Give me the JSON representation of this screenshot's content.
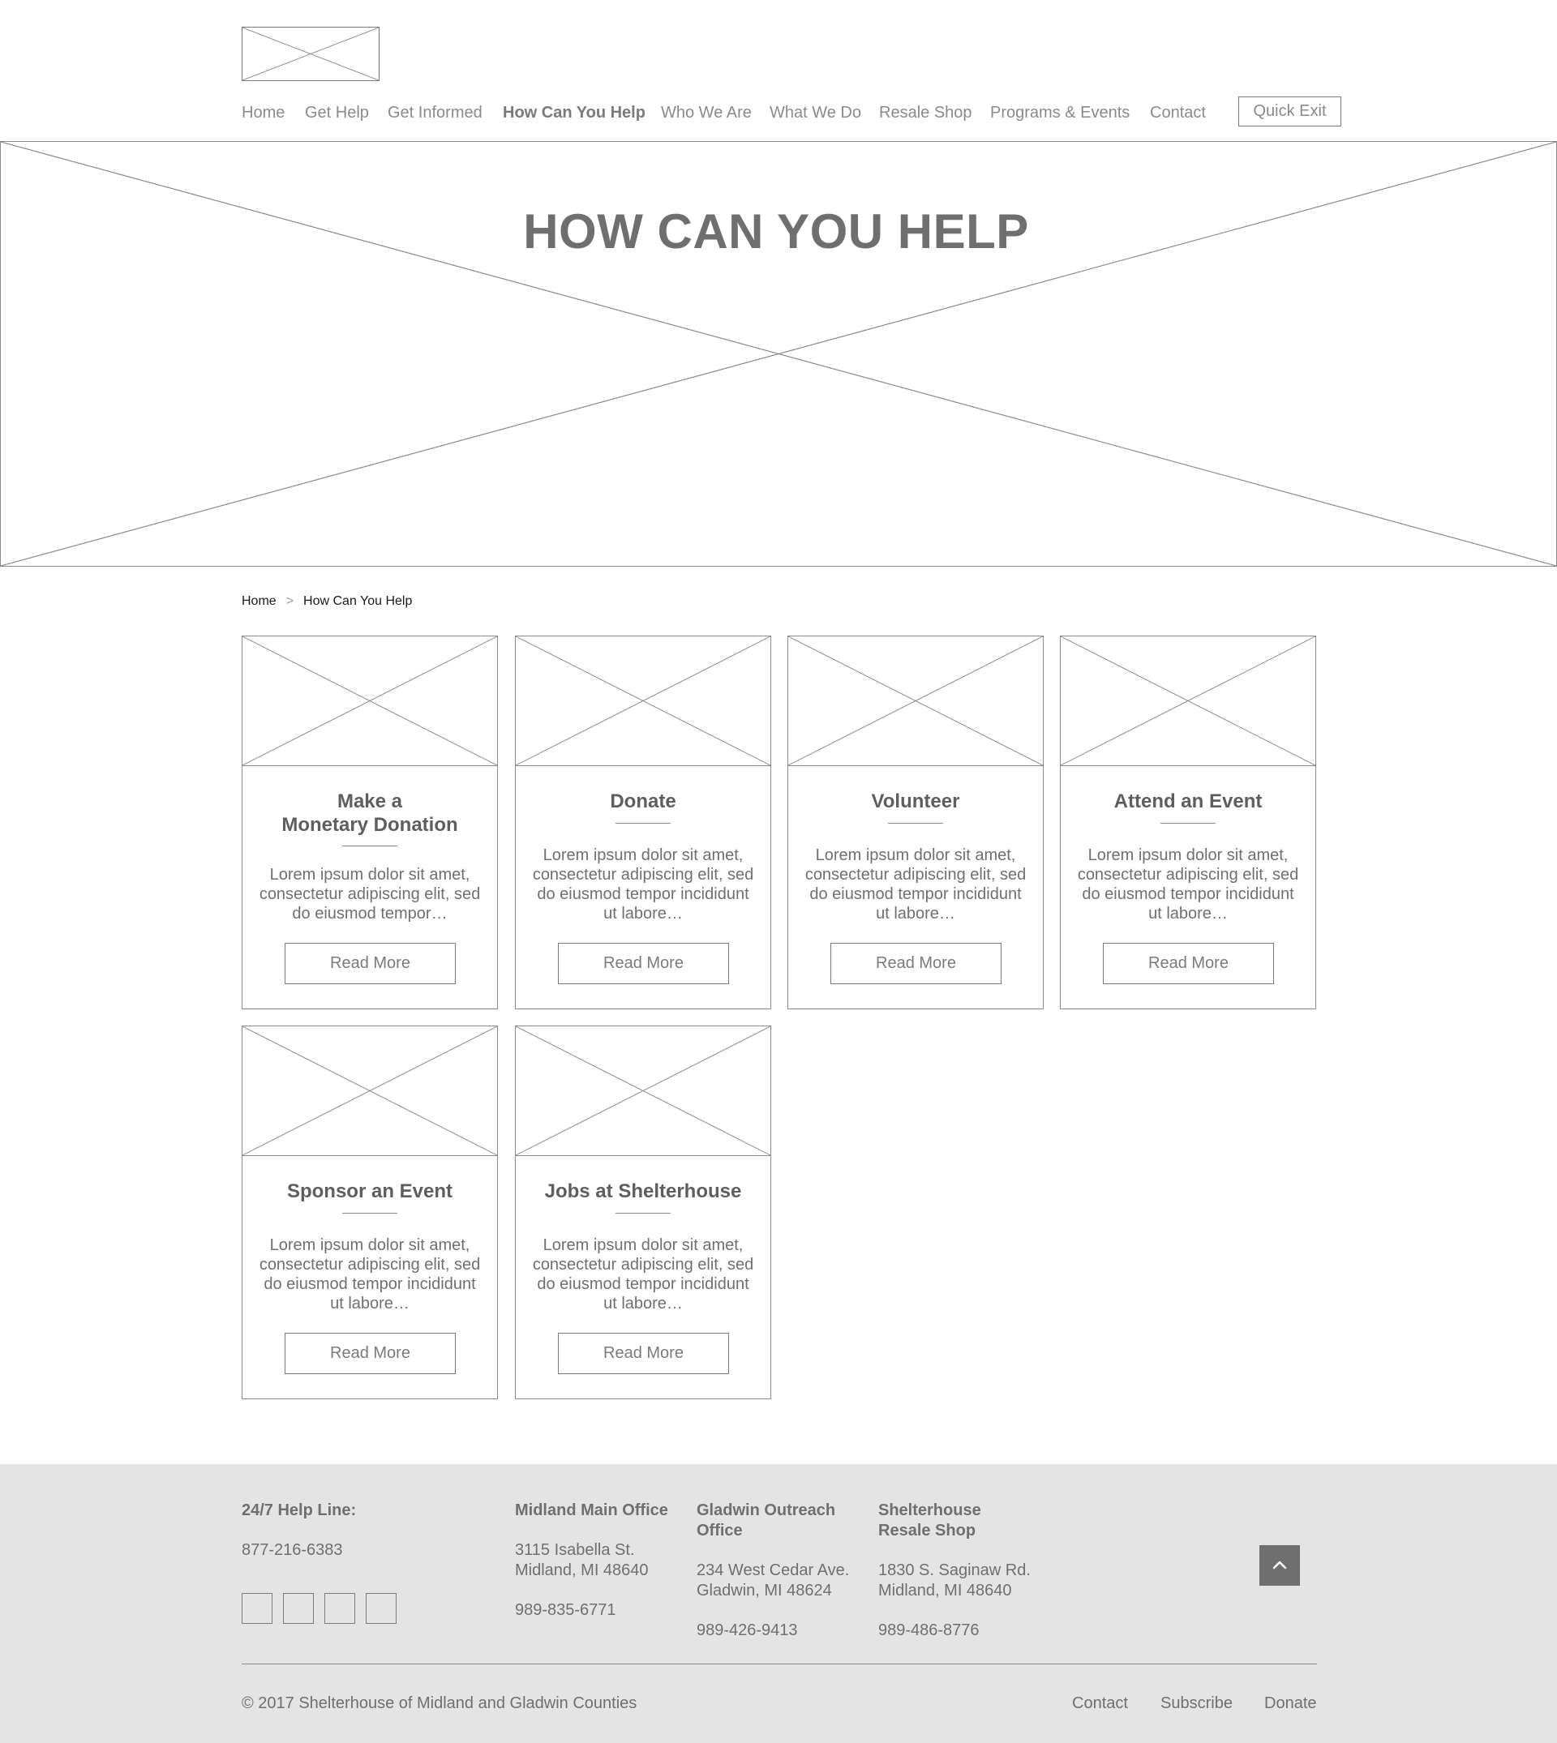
{
  "header": {
    "nav": [
      {
        "label": "Home",
        "active": false
      },
      {
        "label": "Get Help",
        "active": false
      },
      {
        "label": "Get Informed",
        "active": false
      },
      {
        "label": "How Can You Help",
        "active": true
      },
      {
        "label": "Who We Are",
        "active": false
      },
      {
        "label": "What We Do",
        "active": false
      },
      {
        "label": "Resale Shop",
        "active": false
      },
      {
        "label": "Programs & Events",
        "active": false
      },
      {
        "label": "Contact",
        "active": false
      }
    ],
    "quick_exit_label": "Quick Exit"
  },
  "hero": {
    "title": "HOW CAN YOU HELP"
  },
  "breadcrumb": {
    "home": "Home",
    "separator": ">",
    "current": "How Can You Help"
  },
  "cards": [
    {
      "title": "Make a\nMonetary Donation",
      "text": "Lorem ipsum dolor sit amet, consectetur adipiscing elit, sed do eiusmod tempor…",
      "button": "Read More"
    },
    {
      "title": "Donate",
      "text": "Lorem ipsum dolor sit amet, consectetur adipiscing elit, sed do eiusmod tempor incididunt ut labore…",
      "button": "Read More"
    },
    {
      "title": "Volunteer",
      "text": "Lorem ipsum dolor sit amet, consectetur adipiscing elit, sed do eiusmod tempor incididunt ut labore…",
      "button": "Read More"
    },
    {
      "title": "Attend an Event",
      "text": "Lorem ipsum dolor sit amet, consectetur adipiscing elit, sed do eiusmod tempor incididunt ut labore…",
      "button": "Read More"
    },
    {
      "title": "Sponsor an Event",
      "text": "Lorem ipsum dolor sit amet, consectetur adipiscing elit, sed do eiusmod tempor incididunt ut labore…",
      "button": "Read More"
    },
    {
      "title": "Jobs at Shelterhouse",
      "text": "Lorem ipsum dolor sit amet, consectetur adipiscing elit, sed do eiusmod tempor incididunt ut labore…",
      "button": "Read More"
    }
  ],
  "footer": {
    "helpline": {
      "heading": "24/7 Help Line:",
      "phone": "877-216-6383"
    },
    "midland": {
      "heading": "Midland Main Office",
      "address1": "3115 Isabella St.",
      "address2": "Midland, MI 48640",
      "phone": "989-835-6771"
    },
    "gladwin": {
      "heading1": "Gladwin Outreach",
      "heading2": "Office",
      "address1": "234 West Cedar Ave.",
      "address2": "Gladwin, MI 48624",
      "phone": "989-426-9413"
    },
    "resale": {
      "heading1": "Shelterhouse",
      "heading2": "Resale Shop",
      "address1": "1830 S. Saginaw Rd.",
      "address2": "Midland, MI 48640",
      "phone": "989-486-8776"
    },
    "copyright": "© 2017 Shelterhouse of Midland and Gladwin Counties",
    "links": {
      "contact": "Contact",
      "subscribe": "Subscribe",
      "donate": "Donate"
    }
  },
  "colors": {
    "text": "#6f6f6f",
    "border": "#8a8a8a",
    "footer_bg": "#e4e4e4",
    "to_top_bg": "#6f6f6f"
  },
  "icons": {
    "to_top": "chevron-up-icon",
    "social": [
      "social-icon-1",
      "social-icon-2",
      "social-icon-3",
      "social-icon-4"
    ]
  }
}
